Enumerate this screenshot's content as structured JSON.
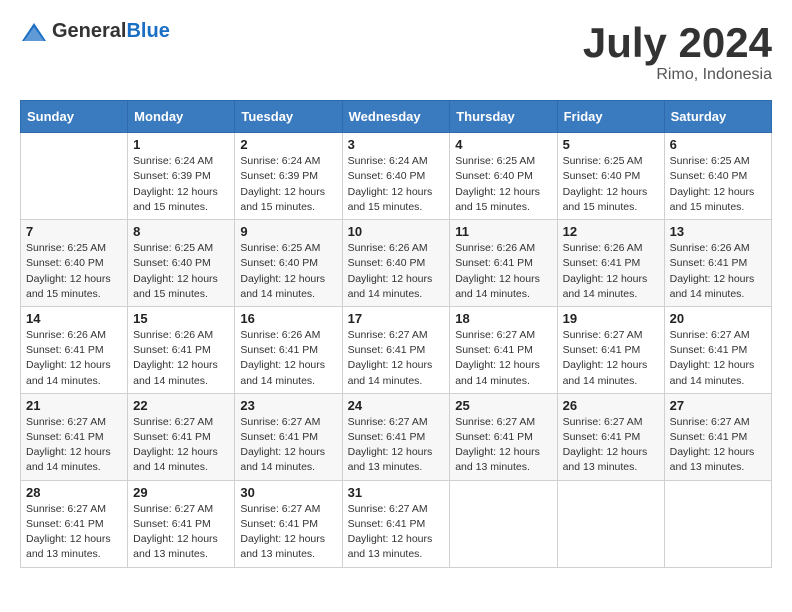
{
  "logo": {
    "general": "General",
    "blue": "Blue"
  },
  "title": {
    "month_year": "July 2024",
    "location": "Rimo, Indonesia"
  },
  "days_of_week": [
    "Sunday",
    "Monday",
    "Tuesday",
    "Wednesday",
    "Thursday",
    "Friday",
    "Saturday"
  ],
  "weeks": [
    [
      {
        "day": "",
        "detail": ""
      },
      {
        "day": "1",
        "detail": "Sunrise: 6:24 AM\nSunset: 6:39 PM\nDaylight: 12 hours and 15 minutes."
      },
      {
        "day": "2",
        "detail": "Sunrise: 6:24 AM\nSunset: 6:39 PM\nDaylight: 12 hours and 15 minutes."
      },
      {
        "day": "3",
        "detail": "Sunrise: 6:24 AM\nSunset: 6:40 PM\nDaylight: 12 hours and 15 minutes."
      },
      {
        "day": "4",
        "detail": "Sunrise: 6:25 AM\nSunset: 6:40 PM\nDaylight: 12 hours and 15 minutes."
      },
      {
        "day": "5",
        "detail": "Sunrise: 6:25 AM\nSunset: 6:40 PM\nDaylight: 12 hours and 15 minutes."
      },
      {
        "day": "6",
        "detail": "Sunrise: 6:25 AM\nSunset: 6:40 PM\nDaylight: 12 hours and 15 minutes."
      }
    ],
    [
      {
        "day": "7",
        "detail": "Sunrise: 6:25 AM\nSunset: 6:40 PM\nDaylight: 12 hours and 15 minutes."
      },
      {
        "day": "8",
        "detail": "Sunrise: 6:25 AM\nSunset: 6:40 PM\nDaylight: 12 hours and 15 minutes."
      },
      {
        "day": "9",
        "detail": "Sunrise: 6:25 AM\nSunset: 6:40 PM\nDaylight: 12 hours and 14 minutes."
      },
      {
        "day": "10",
        "detail": "Sunrise: 6:26 AM\nSunset: 6:40 PM\nDaylight: 12 hours and 14 minutes."
      },
      {
        "day": "11",
        "detail": "Sunrise: 6:26 AM\nSunset: 6:41 PM\nDaylight: 12 hours and 14 minutes."
      },
      {
        "day": "12",
        "detail": "Sunrise: 6:26 AM\nSunset: 6:41 PM\nDaylight: 12 hours and 14 minutes."
      },
      {
        "day": "13",
        "detail": "Sunrise: 6:26 AM\nSunset: 6:41 PM\nDaylight: 12 hours and 14 minutes."
      }
    ],
    [
      {
        "day": "14",
        "detail": "Sunrise: 6:26 AM\nSunset: 6:41 PM\nDaylight: 12 hours and 14 minutes."
      },
      {
        "day": "15",
        "detail": "Sunrise: 6:26 AM\nSunset: 6:41 PM\nDaylight: 12 hours and 14 minutes."
      },
      {
        "day": "16",
        "detail": "Sunrise: 6:26 AM\nSunset: 6:41 PM\nDaylight: 12 hours and 14 minutes."
      },
      {
        "day": "17",
        "detail": "Sunrise: 6:27 AM\nSunset: 6:41 PM\nDaylight: 12 hours and 14 minutes."
      },
      {
        "day": "18",
        "detail": "Sunrise: 6:27 AM\nSunset: 6:41 PM\nDaylight: 12 hours and 14 minutes."
      },
      {
        "day": "19",
        "detail": "Sunrise: 6:27 AM\nSunset: 6:41 PM\nDaylight: 12 hours and 14 minutes."
      },
      {
        "day": "20",
        "detail": "Sunrise: 6:27 AM\nSunset: 6:41 PM\nDaylight: 12 hours and 14 minutes."
      }
    ],
    [
      {
        "day": "21",
        "detail": "Sunrise: 6:27 AM\nSunset: 6:41 PM\nDaylight: 12 hours and 14 minutes."
      },
      {
        "day": "22",
        "detail": "Sunrise: 6:27 AM\nSunset: 6:41 PM\nDaylight: 12 hours and 14 minutes."
      },
      {
        "day": "23",
        "detail": "Sunrise: 6:27 AM\nSunset: 6:41 PM\nDaylight: 12 hours and 14 minutes."
      },
      {
        "day": "24",
        "detail": "Sunrise: 6:27 AM\nSunset: 6:41 PM\nDaylight: 12 hours and 13 minutes."
      },
      {
        "day": "25",
        "detail": "Sunrise: 6:27 AM\nSunset: 6:41 PM\nDaylight: 12 hours and 13 minutes."
      },
      {
        "day": "26",
        "detail": "Sunrise: 6:27 AM\nSunset: 6:41 PM\nDaylight: 12 hours and 13 minutes."
      },
      {
        "day": "27",
        "detail": "Sunrise: 6:27 AM\nSunset: 6:41 PM\nDaylight: 12 hours and 13 minutes."
      }
    ],
    [
      {
        "day": "28",
        "detail": "Sunrise: 6:27 AM\nSunset: 6:41 PM\nDaylight: 12 hours and 13 minutes."
      },
      {
        "day": "29",
        "detail": "Sunrise: 6:27 AM\nSunset: 6:41 PM\nDaylight: 12 hours and 13 minutes."
      },
      {
        "day": "30",
        "detail": "Sunrise: 6:27 AM\nSunset: 6:41 PM\nDaylight: 12 hours and 13 minutes."
      },
      {
        "day": "31",
        "detail": "Sunrise: 6:27 AM\nSunset: 6:41 PM\nDaylight: 12 hours and 13 minutes."
      },
      {
        "day": "",
        "detail": ""
      },
      {
        "day": "",
        "detail": ""
      },
      {
        "day": "",
        "detail": ""
      }
    ]
  ]
}
